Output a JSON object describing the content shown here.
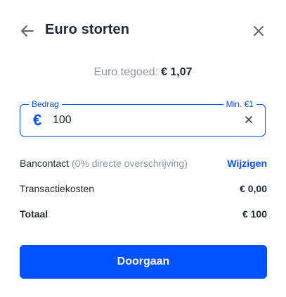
{
  "header": {
    "title": "Euro storten",
    "back_icon": "arrow-left-icon",
    "close_icon": "close-icon"
  },
  "balance": {
    "label": "Euro tegoed:",
    "amount": "€ 1,07"
  },
  "amount_field": {
    "label": "Bedrag",
    "min_label": "Min. €1",
    "currency_symbol": "€",
    "value": "100",
    "clear_icon": "clear-icon"
  },
  "payment": {
    "method": "Bancontact",
    "method_note": "(0% directe overschrijving)",
    "change_label": "Wijzigen"
  },
  "fees": {
    "label": "Transactiekosten",
    "value": "€ 0,00"
  },
  "total": {
    "label": "Totaal",
    "value": "€ 100"
  },
  "cta": {
    "label": "Doorgaan"
  },
  "colors": {
    "accent": "#0052ff",
    "text": "#1f2a37",
    "muted": "#8a95a3"
  }
}
